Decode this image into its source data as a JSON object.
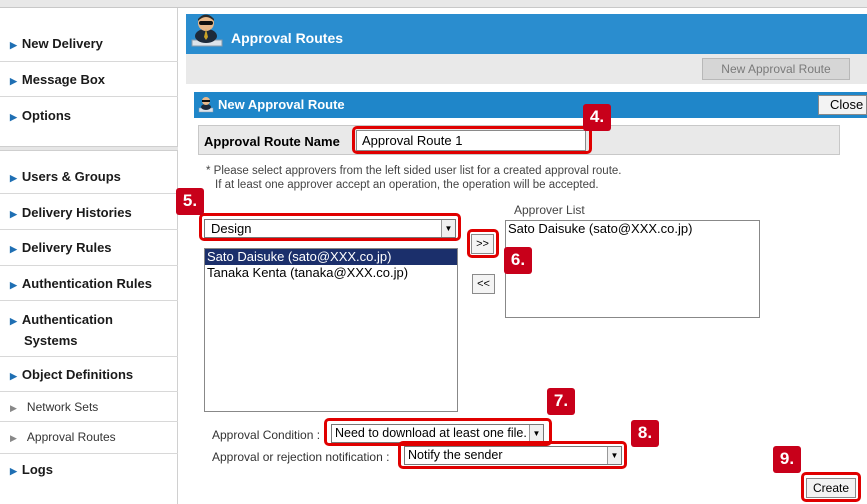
{
  "sidebar": {
    "items": [
      {
        "label": "New Delivery"
      },
      {
        "label": "Message Box"
      },
      {
        "label": "Options"
      },
      {
        "label": "Users & Groups"
      },
      {
        "label": "Delivery Histories"
      },
      {
        "label": "Delivery Rules"
      },
      {
        "label": "Authentication Rules"
      },
      {
        "label": "Authentication\nSystems"
      },
      {
        "label": "Object Definitions"
      },
      {
        "label": "Network Sets"
      },
      {
        "label": "Approval Routes"
      },
      {
        "label": "Logs"
      }
    ]
  },
  "header": {
    "title": "Approval Routes",
    "new_route_button": "New Approval Route"
  },
  "panel": {
    "title": "New Approval Route",
    "close_button": "Close",
    "route_name_label": "Approval Route Name",
    "route_name_value": "Approval Route 1",
    "note_line1": "* Please select approvers from the left sided user list for a created approval route.",
    "note_line2": "If at least one approver accept an operation, the operation will be accepted.",
    "group_select": "Design",
    "users": [
      "Sato Daisuke (sato@XXX.co.jp)",
      "Tanaka Kenta (tanaka@XXX.co.jp)"
    ],
    "approver_list_label": "Approver List",
    "approvers": [
      "Sato Daisuke (sato@XXX.co.jp)"
    ],
    "add_button": ">>",
    "remove_button": "<<",
    "condition_label": "Approval Condition :",
    "condition_value": "Need to download at least one file.",
    "notify_label": "Approval or rejection notification :",
    "notify_value": "Notify the sender",
    "create_button": "Create"
  },
  "callouts": [
    "4.",
    "5.",
    "6.",
    "7.",
    "8.",
    "9."
  ],
  "colors": {
    "header_blue": "#2a8dcf",
    "panel_blue": "#1f86c9",
    "callout_red": "#c8001a",
    "highlight_red": "#e00000",
    "selected_row": "#1b2f6b"
  },
  "icons": {
    "header": "admin-user-icon",
    "panel": "admin-user-icon",
    "nav": "triangle-right-icon"
  }
}
